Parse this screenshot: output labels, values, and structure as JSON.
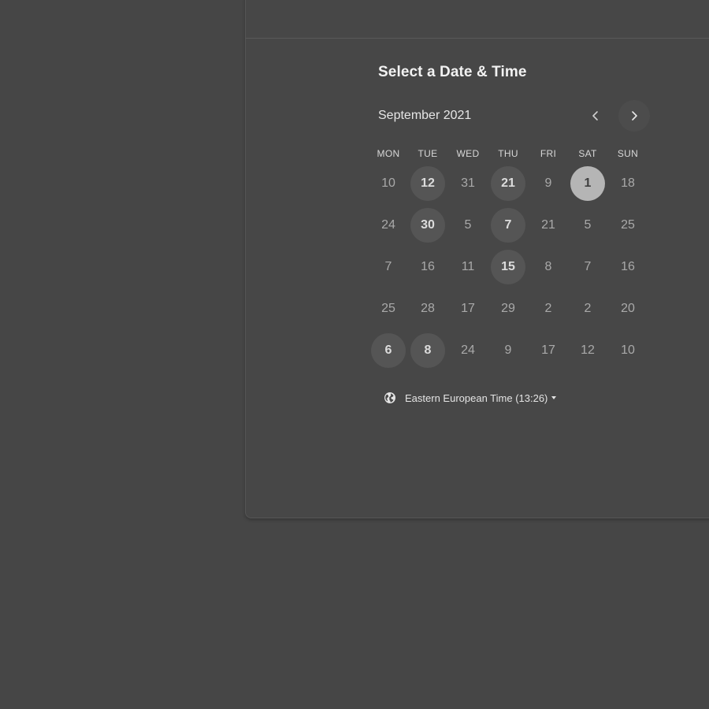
{
  "scheduler": {
    "title": "Select a Date & Time",
    "month_label": "September 2021",
    "weekdays": [
      "MON",
      "TUE",
      "WED",
      "THU",
      "FRI",
      "SAT",
      "SUN"
    ],
    "weeks": [
      [
        "10",
        "12",
        "31",
        "21",
        "9",
        "1",
        "18"
      ],
      [
        "24",
        "30",
        "5",
        "7",
        "21",
        "5",
        "25"
      ],
      [
        "7",
        "16",
        "11",
        "15",
        "8",
        "7",
        "16"
      ],
      [
        "25",
        "28",
        "17",
        "29",
        "2",
        "2",
        "20"
      ],
      [
        "6",
        "8",
        "24",
        "9",
        "17",
        "12",
        "10"
      ]
    ],
    "available_days": [
      "12",
      "21",
      "1",
      "30",
      "7",
      "15",
      "6",
      "8"
    ],
    "selected_day": "1",
    "timezone_label": "Eastern European Time (13:26)",
    "icons": {
      "prev": "chevron-left-icon",
      "next": "chevron-right-icon",
      "timezone": "globe-icon",
      "timezone_dropdown": "caret-down-icon"
    },
    "colors": {
      "background": "#464646",
      "available_day_bg": "#555555",
      "selected_day_bg": "#b5b5b5"
    }
  }
}
